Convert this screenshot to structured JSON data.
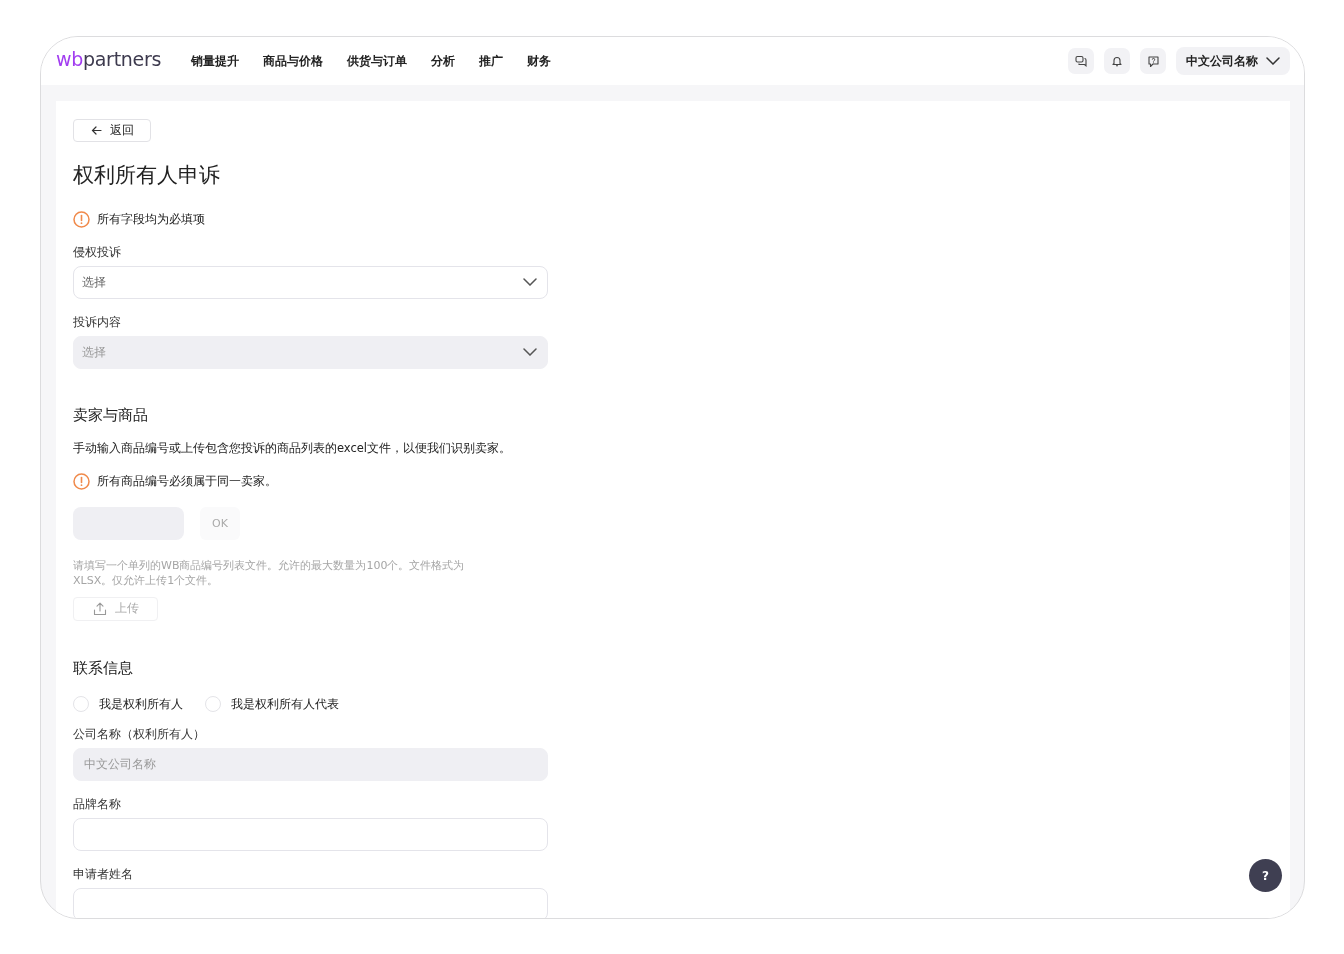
{
  "header": {
    "logo": {
      "accent": "wb",
      "rest": "partners"
    },
    "nav": [
      "销量提升",
      "商品与价格",
      "供货与订单",
      "分析",
      "推广",
      "财务"
    ],
    "account": "中文公司名称"
  },
  "back_button": "返回",
  "title": "权利所有人申诉",
  "required_notice": "所有字段均为必填项",
  "complaint_fields": [
    {
      "label": "侵权投诉",
      "placeholder": "选择",
      "disabled": false
    },
    {
      "label": "投诉内容",
      "placeholder": "选择",
      "disabled": true
    }
  ],
  "seller_section": {
    "heading": "卖家与商品",
    "description": "手动输入商品编号或上传包含您投诉的商品列表的excel文件，以便我们识别卖家。",
    "notice": "所有商品编号必须属于同一卖家。",
    "product_id_input": {
      "disabled": true
    },
    "ok_button": {
      "label": "OK",
      "disabled": true
    },
    "hint": "请填写一个单列的WB商品编号列表文件。允许的最大数量为100个。文件格式为XLSX。仅允许上传1个文件。",
    "upload_button": {
      "label": "上传",
      "disabled": true
    }
  },
  "contact_section": {
    "heading": "联系信息",
    "roles": [
      {
        "label": "我是权利所有人",
        "selected": false
      },
      {
        "label": "我是权利所有人代表",
        "selected": false
      }
    ],
    "fields": [
      {
        "label": "公司名称（权利所有人）",
        "value": "中文公司名称",
        "disabled": true
      },
      {
        "label": "品牌名称",
        "disabled": false
      },
      {
        "label": "申请者姓名",
        "disabled": false
      }
    ]
  },
  "help_button": "?"
}
